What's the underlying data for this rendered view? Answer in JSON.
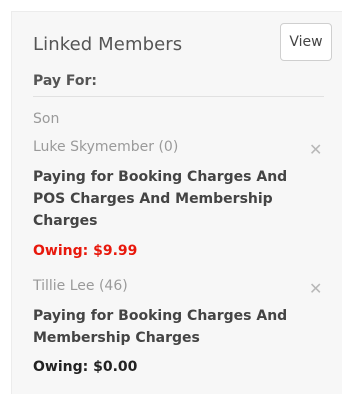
{
  "panel": {
    "title": "Linked Members",
    "view_label": "View",
    "pay_for_label": "Pay For:"
  },
  "relation_label": "Son",
  "members": [
    {
      "name": "Luke Skymember (0)",
      "description": "Paying for Booking Charges And POS Charges And Membership Charges",
      "owing": "Owing: $9.99",
      "owing_color": "#e8180c"
    },
    {
      "name": "Tillie Lee (46)",
      "description": "Paying for Booking Charges And Membership Charges",
      "owing": "Owing: $0.00",
      "owing_color": "#222222"
    }
  ],
  "icons": {
    "remove": "close-icon"
  }
}
